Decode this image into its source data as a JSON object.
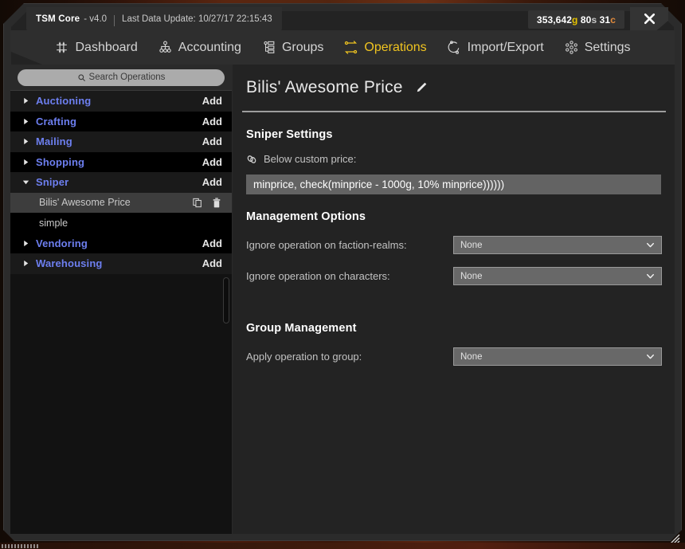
{
  "window": {
    "app_name": "TSM Core",
    "version": "- v4.0",
    "last_update_label": "Last Data Update: 10/27/17 22:15:43",
    "close_label": "Close",
    "accent_gold": "#f0c420",
    "link_blue": "#6d7ff0"
  },
  "money": {
    "gold": "353,642",
    "gold_unit": "g",
    "silver": "80",
    "silver_unit": "s",
    "copper": "31",
    "copper_unit": "c"
  },
  "nav": {
    "items": [
      {
        "label": "Dashboard",
        "icon": "dashboard-icon",
        "active": false
      },
      {
        "label": "Accounting",
        "icon": "accounting-icon",
        "active": false
      },
      {
        "label": "Groups",
        "icon": "groups-icon",
        "active": false
      },
      {
        "label": "Operations",
        "icon": "operations-icon",
        "active": true
      },
      {
        "label": "Import/Export",
        "icon": "import-export-icon",
        "active": false
      },
      {
        "label": "Settings",
        "icon": "settings-icon",
        "active": false
      }
    ]
  },
  "sidebar": {
    "search": {
      "placeholder": "Search Operations",
      "value": "",
      "icon": "search-icon"
    },
    "add_label": "Add",
    "categories": [
      {
        "name": "Auctioning",
        "expanded": false,
        "add": "Add",
        "children": []
      },
      {
        "name": "Crafting",
        "expanded": false,
        "add": "Add",
        "children": []
      },
      {
        "name": "Mailing",
        "expanded": false,
        "add": "Add",
        "children": []
      },
      {
        "name": "Shopping",
        "expanded": false,
        "add": "Add",
        "children": []
      },
      {
        "name": "Sniper",
        "expanded": true,
        "add": "Add",
        "children": [
          {
            "name": "Bilis' Awesome Price",
            "selected": true
          },
          {
            "name": "simple",
            "selected": false
          }
        ]
      },
      {
        "name": "Vendoring",
        "expanded": false,
        "add": "Add",
        "children": []
      },
      {
        "name": "Warehousing",
        "expanded": false,
        "add": "Add",
        "children": []
      }
    ]
  },
  "main": {
    "operation_title": "Bilis' Awesome Price",
    "edit_icon": "pencil-icon",
    "sniper_settings": {
      "heading": "Sniper Settings",
      "link_icon": "link-icon",
      "below_custom_price_label": "Below custom price:",
      "custom_price_value": "minprice, check(minprice - 1000g, 10% minprice))))))"
    },
    "management_options": {
      "heading": "Management Options",
      "fields": [
        {
          "label": "Ignore operation on faction-realms:",
          "value": "None"
        },
        {
          "label": "Ignore operation on characters:",
          "value": "None"
        }
      ]
    },
    "group_management": {
      "heading": "Group Management",
      "fields": [
        {
          "label": "Apply operation to group:",
          "value": "None"
        }
      ]
    }
  }
}
